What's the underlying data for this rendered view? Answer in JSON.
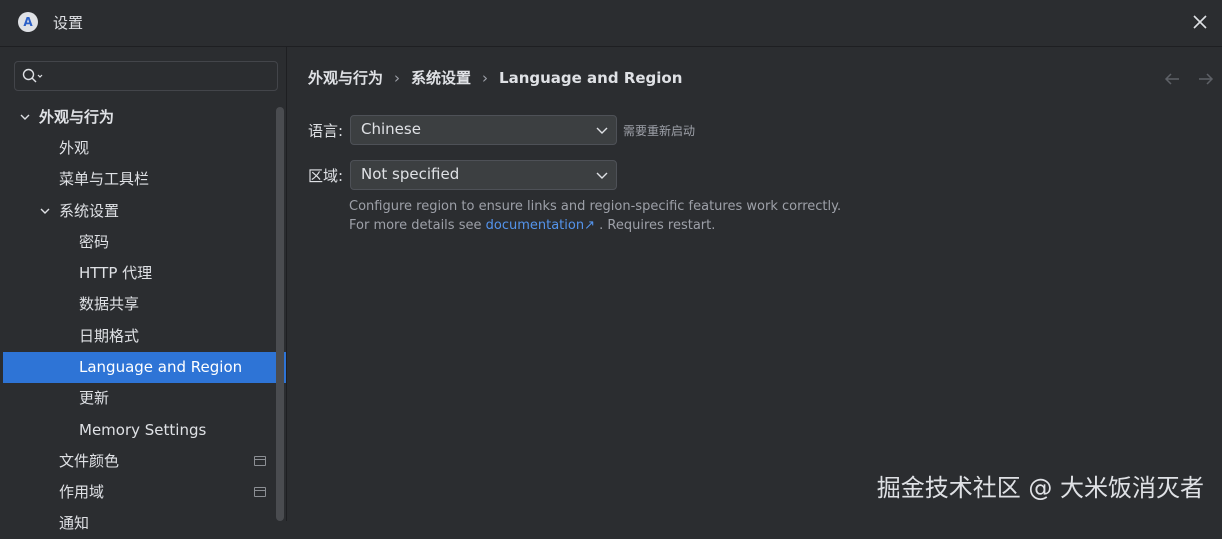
{
  "window": {
    "title": "设置"
  },
  "search": {
    "value": ""
  },
  "sidebar": {
    "items": [
      {
        "label": "外观与行为"
      },
      {
        "label": "外观"
      },
      {
        "label": "菜单与工具栏"
      },
      {
        "label": "系统设置"
      },
      {
        "label": "密码"
      },
      {
        "label": "HTTP 代理"
      },
      {
        "label": "数据共享"
      },
      {
        "label": "日期格式"
      },
      {
        "label": "Language and Region"
      },
      {
        "label": "更新"
      },
      {
        "label": "Memory Settings"
      },
      {
        "label": "文件颜色"
      },
      {
        "label": "作用域"
      },
      {
        "label": "通知"
      }
    ]
  },
  "breadcrumb": [
    "外观与行为",
    "系统设置",
    "Language and Region"
  ],
  "language": {
    "label": "语言:",
    "value": "Chinese",
    "hint": "需要重新启动"
  },
  "region": {
    "label": "区域:",
    "value": "Not specified",
    "desc_line1": "Configure region to ensure links and region-specific features work correctly.",
    "desc_prefix": "For more details see",
    "link": "documentation",
    "link_arrow": "↗",
    "desc_suffix": ". Requires restart."
  },
  "watermark": "掘金技术社区 @ 大米饭消灭者",
  "colors": {
    "selection": "#2e74d6",
    "link": "#5494ec",
    "background": "#2b2d30"
  }
}
